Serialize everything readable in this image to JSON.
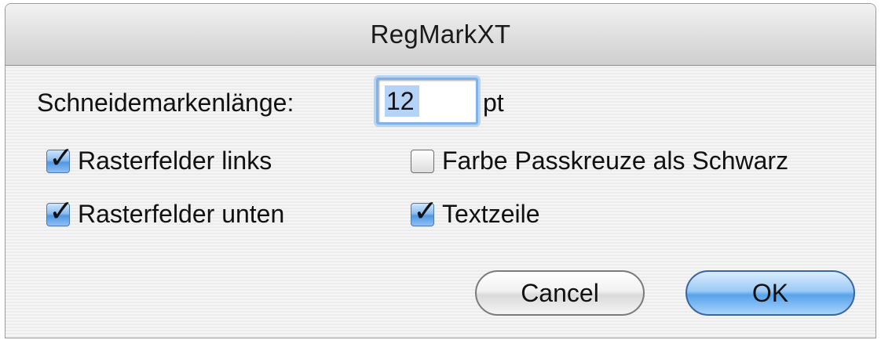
{
  "window": {
    "title": "RegMarkXT"
  },
  "length": {
    "label": "Schneidemarkenlänge:",
    "value": "12",
    "unit": "pt"
  },
  "options": [
    {
      "label": "Rasterfelder links",
      "checked": true
    },
    {
      "label": "Farbe Passkreuze als Schwarz",
      "checked": false
    },
    {
      "label": "Rasterfelder unten",
      "checked": true
    },
    {
      "label": "Textzeile",
      "checked": true
    }
  ],
  "buttons": {
    "cancel_label": "Cancel",
    "ok_label": "OK"
  },
  "colors": {
    "accent": "#58a2ea",
    "focus_ring": "#7eb2ea"
  }
}
